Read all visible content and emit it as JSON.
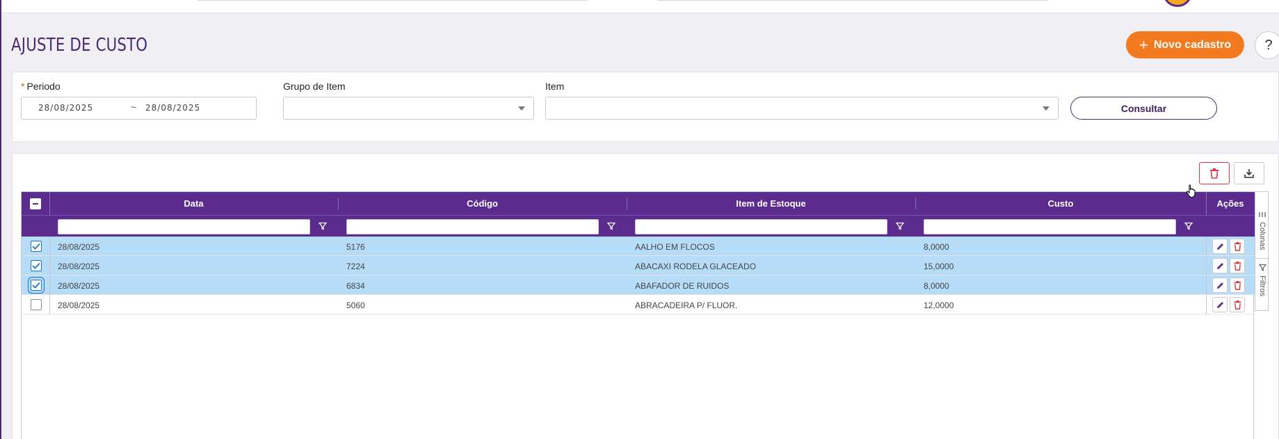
{
  "page": {
    "title": "AJUSTE DE CUSTO",
    "new_button": "Novo cadastro",
    "new_button_icon": "plus-icon",
    "help_button": "?"
  },
  "filters": {
    "periodo_label": "Periodo",
    "required_mark": "*",
    "date_from": "28/08/2025",
    "date_separator": "~",
    "date_to": "28/08/2025",
    "grupo_label": "Grupo de Item",
    "grupo_value": "",
    "item_label": "Item",
    "item_value": "",
    "consultar_button": "Consultar"
  },
  "toolbar": {
    "delete_icon": "trash-icon",
    "export_icon": "download-icon"
  },
  "grid": {
    "columns": [
      "Data",
      "Código",
      "Item de Estoque",
      "Custo",
      "Ações"
    ],
    "rows": [
      {
        "data": "28/08/2025",
        "codigo": "5176",
        "item": "AALHO EM FLOCOS",
        "custo": "8,0000",
        "selected": true
      },
      {
        "data": "28/08/2025",
        "codigo": "7224",
        "item": "ABACAXI RODELA GLACEADO",
        "custo": "15,0000",
        "selected": true
      },
      {
        "data": "28/08/2025",
        "codigo": "6834",
        "item": "ABAFADOR DE RUIDOS",
        "custo": "8,0000",
        "selected": true
      },
      {
        "data": "28/08/2025",
        "codigo": "5060",
        "item": "ABRACADEIRA P/ FLUOR.",
        "custo": "12,0000",
        "selected": false
      }
    ],
    "side_tabs": [
      "Colunas",
      "Filtros"
    ]
  },
  "colors": {
    "brand_purple": "#5b2c8e",
    "accent_orange": "#f47a1f",
    "selected_row": "#b7dcf7",
    "delete_red": "#d9363e"
  }
}
